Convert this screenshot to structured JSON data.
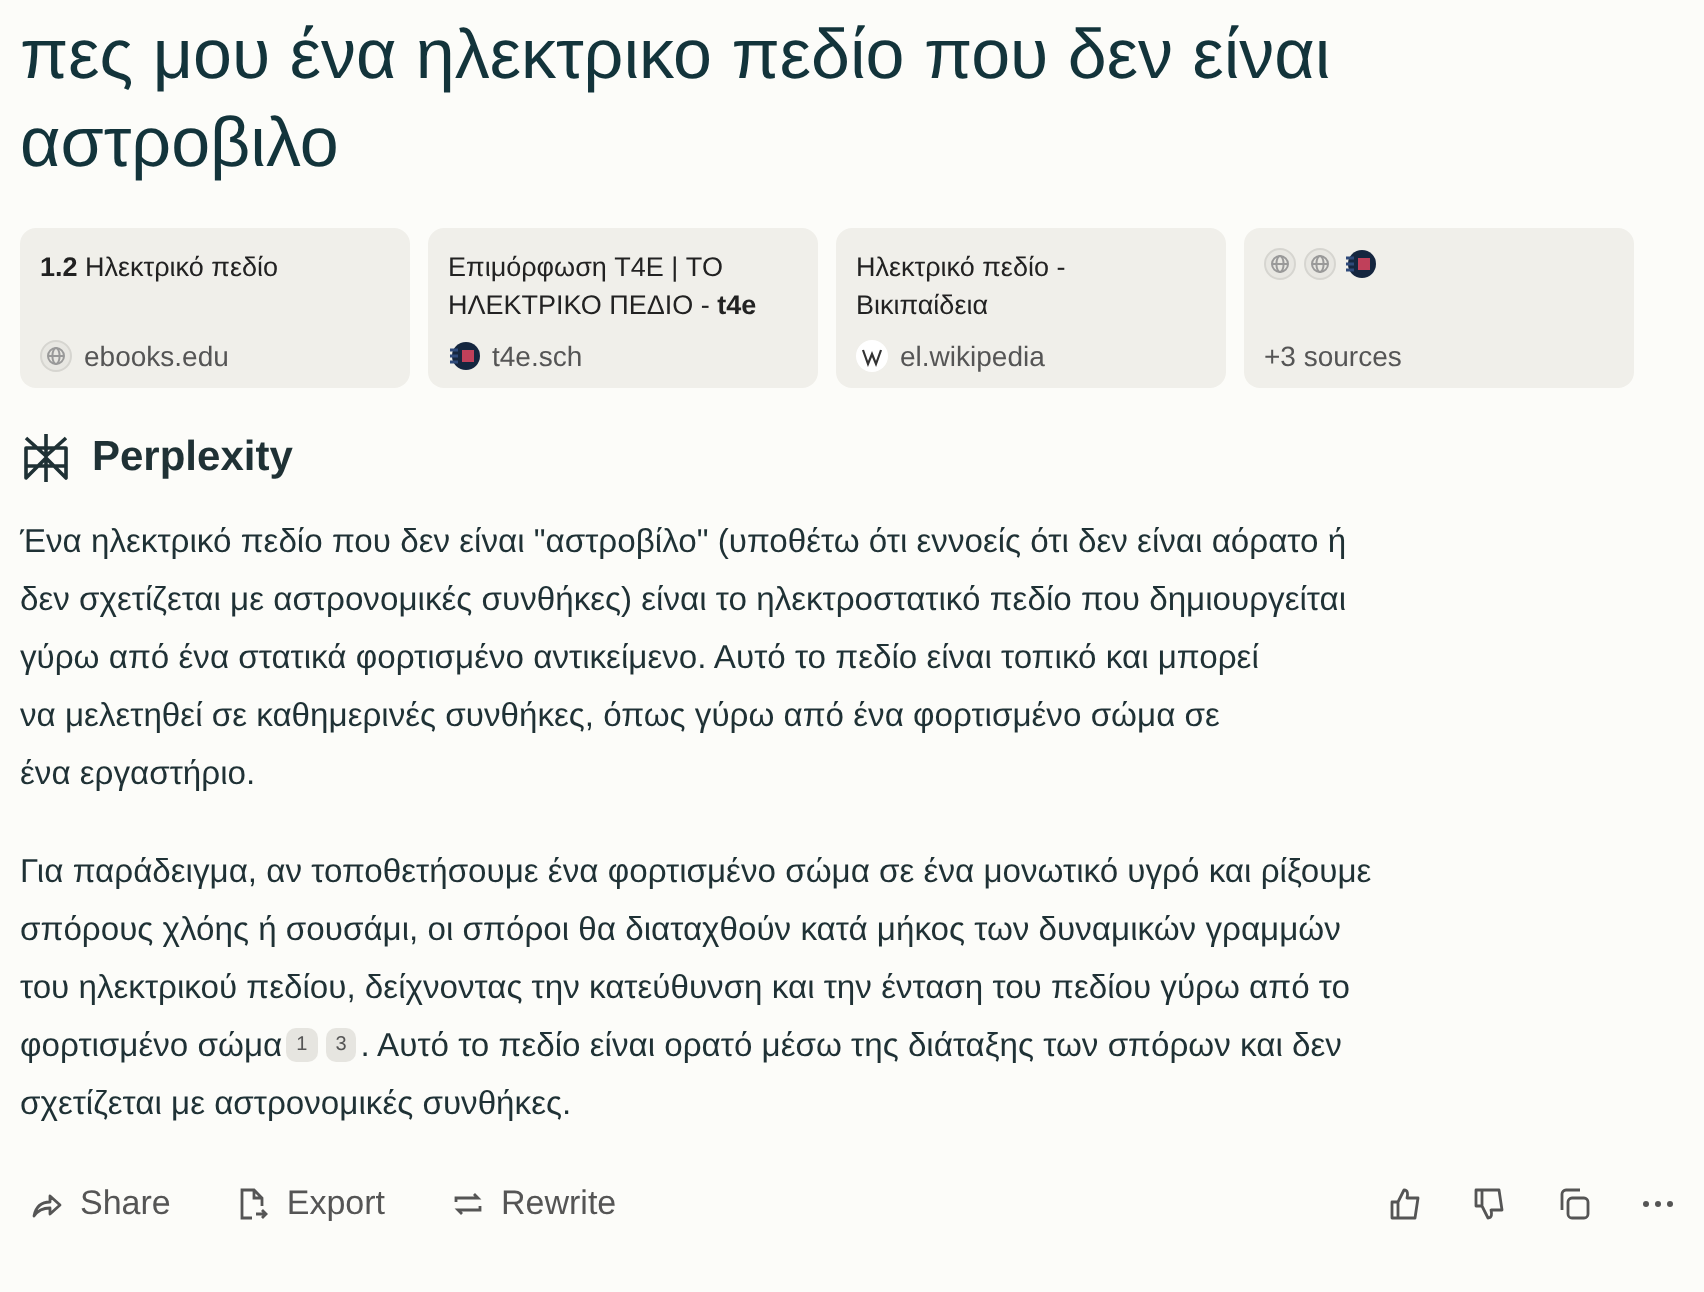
{
  "question": "πες μου ένα ηλεκτρικο πεδίο που δεν είναι αστροβιλο",
  "sources": [
    {
      "kind": "source",
      "title": "**1.2** Ηλεκτρικό πεδίο",
      "site": "ebooks.edu"
    },
    {
      "kind": "source",
      "title": "Επιμόρφωση T4E | ΤΟ ΗΛΕΚΤΡΙΚΟ ΠΕΔΙΟ - **t4e**",
      "site": "t4e.sch"
    },
    {
      "kind": "source",
      "title": "Ηλεκτρικό πεδίο - Βικιπαίδεια",
      "site": "el.wikipedia"
    },
    {
      "kind": "more",
      "label": "+3 sources"
    }
  ],
  "answer_header": "Perplexity",
  "paragraphs": [
    {
      "lines": [
        [
          {
            "kind": "text",
            "text": "Ένα ηλεκτρικό πεδίο που δεν είναι \"αστροβίλο\" (υποθέτω ότι εννοείς ότι δεν είναι αόρατο ή"
          }
        ],
        [
          {
            "kind": "text",
            "text": "δεν σχετίζεται με αστρονομικές συνθήκες) είναι το ηλεκτροστατικό πεδίο που δημιουργείται"
          }
        ],
        [
          {
            "kind": "text",
            "text": "γύρω από ένα στατικά φορτισμένο αντικείμενο. Αυτό το πεδίο είναι τοπικό και μπορεί"
          }
        ],
        [
          {
            "kind": "text",
            "text": "να μελετηθεί σε καθημερινές συνθήκες, όπως γύρω από ένα φορτισμένο σώμα σε"
          }
        ],
        [
          {
            "kind": "text",
            "text": "ένα εργαστήριο."
          }
        ]
      ]
    },
    {
      "lines": [
        [
          {
            "kind": "text",
            "text": "Για παράδειγμα, αν τοποθετήσουμε ένα φορτισμένο σώμα σε ένα μονωτικό υγρό και ρίξουμε"
          }
        ],
        [
          {
            "kind": "text",
            "text": "σπόρους χλόης ή σουσάμι, οι σπόροι θα διαταχθούν κατά μήκος των δυναμικών γραμμών"
          }
        ],
        [
          {
            "kind": "text",
            "text": "του ηλεκτρικού πεδίου, δείχνοντας την κατεύθυνση και την ένταση του πεδίου γύρω από το"
          }
        ],
        [
          {
            "kind": "text",
            "text": "φορτισμένο σώμα"
          },
          {
            "kind": "citation",
            "text": "1"
          },
          {
            "kind": "citation",
            "text": "3"
          },
          {
            "kind": "text",
            "text": ". Αυτό το πεδίο είναι ορατό μέσω της διάταξης των σπόρων και δεν"
          }
        ],
        [
          {
            "kind": "text",
            "text": "σχετίζεται με αστρονομικές συνθήκες."
          }
        ]
      ]
    }
  ],
  "actions": [
    "Share",
    "Export",
    "Rewrite"
  ]
}
